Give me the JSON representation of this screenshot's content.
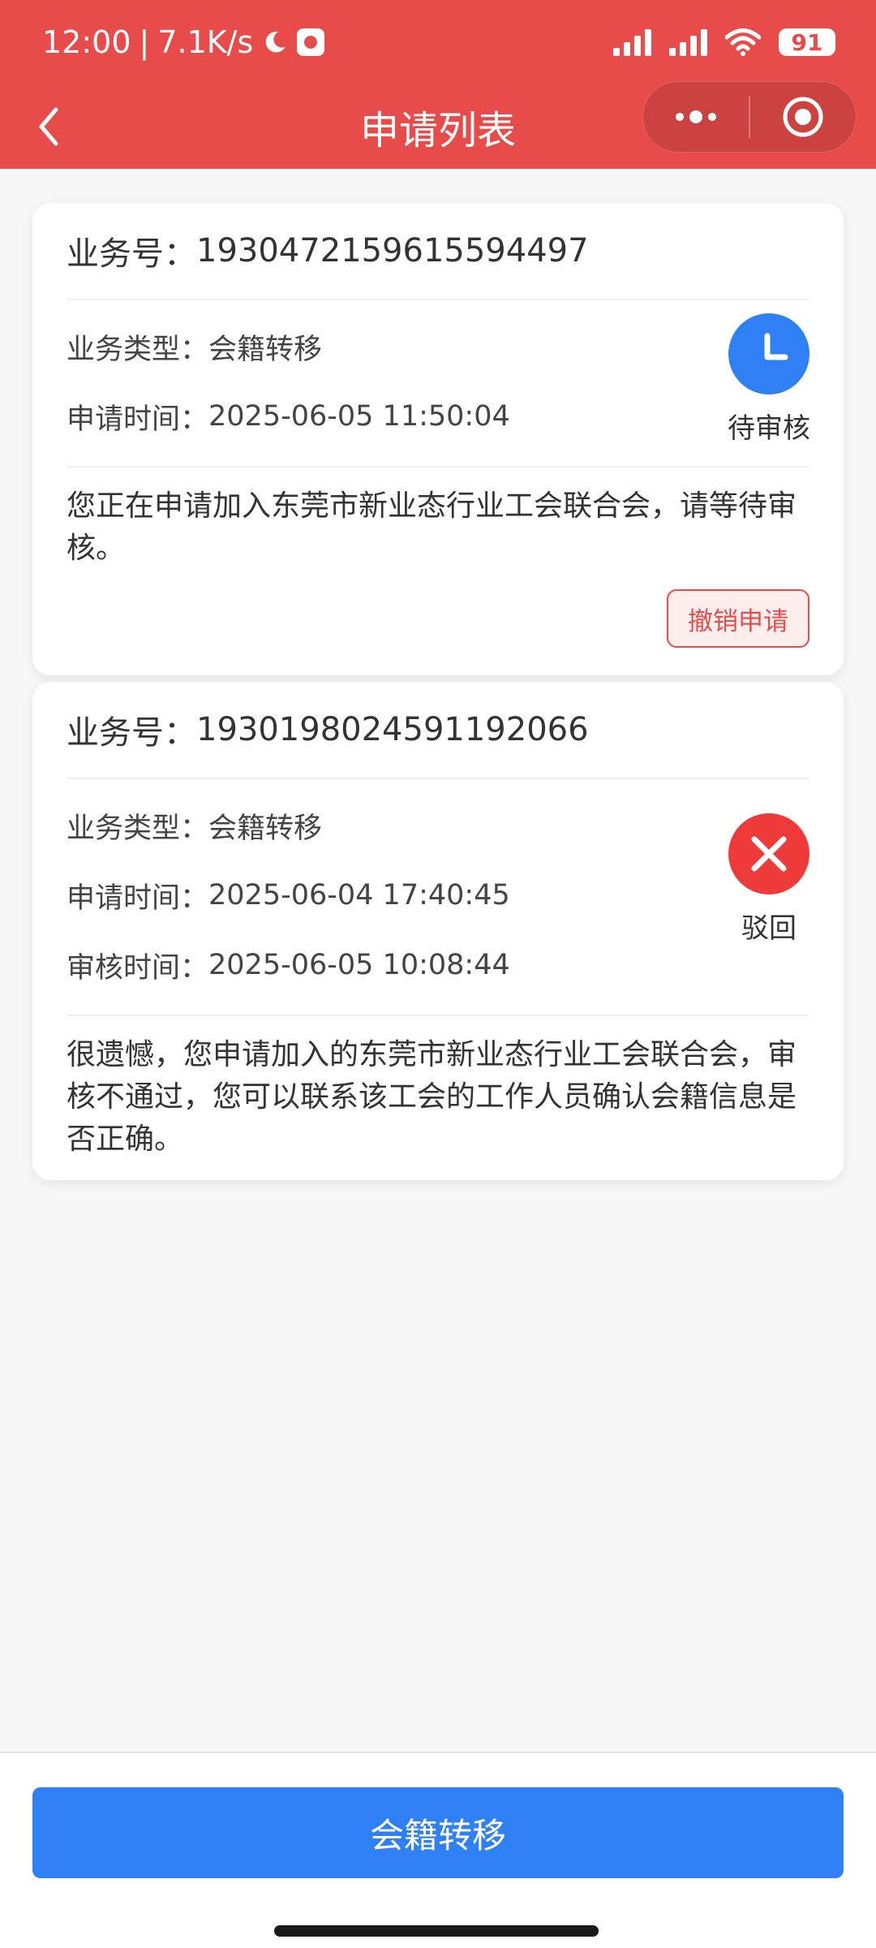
{
  "status_bar": {
    "time": "12:00",
    "separator": "|",
    "speed": "7.1K/s",
    "battery": "91"
  },
  "nav": {
    "title": "申请列表"
  },
  "applications": [
    {
      "business_no_label": "业务号：",
      "business_no": "1930472159615594497",
      "type_label": "业务类型：",
      "type_value": "会籍转移",
      "apply_time_label": "申请时间：",
      "apply_time": "2025-06-05 11:50:04",
      "status": "待审核",
      "status_color": "#2f80f5",
      "description": "您正在申请加入东莞市新业态行业工会联合会，请等待审核。",
      "action_label": "撤销申请"
    },
    {
      "business_no_label": "业务号：",
      "business_no": "1930198024591192066",
      "type_label": "业务类型：",
      "type_value": "会籍转移",
      "apply_time_label": "申请时间：",
      "apply_time": "2025-06-04 17:40:45",
      "review_time_label": "审核时间：",
      "review_time": "2025-06-05 10:08:44",
      "status": "驳回",
      "status_color": "#ef3a3a",
      "description": "很遗憾，您申请加入的东莞市新业态行业工会联合会，审核不通过，您可以联系该工会的工作人员确认会籍信息是否正确。"
    }
  ],
  "bottom": {
    "primary_label": "会籍转移"
  },
  "colors": {
    "brand": "#e84c4a",
    "primary": "#2f80f5",
    "danger": "#ef3a3a"
  }
}
